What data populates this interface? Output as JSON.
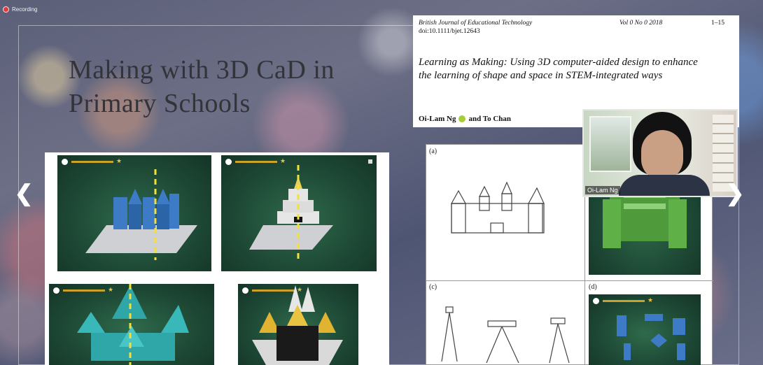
{
  "recording": {
    "label": "Recording"
  },
  "slide": {
    "title": "Making with 3D CaD in Primary Schools"
  },
  "document": {
    "journal": "British Journal of Educational Technology",
    "volume": "Vol 0 No 0 2018",
    "pages": "1–15",
    "doi": "doi:10.1111/bjet.12643",
    "title": "Learning as Making: Using 3D computer-aided design to enhance the learning of shape and space in STEM-integrated ways",
    "author_1": "Oi-Lam Ng",
    "author_connector": "and To Chan"
  },
  "figure": {
    "label_a": "(a)",
    "label_c": "(c)",
    "label_d": "(d)"
  },
  "video": {
    "participant_name": "Oi-Lam Ng"
  },
  "colors": {
    "accent_yellow": "#f3e03c",
    "castle_blue": "#2f6fb0",
    "tile_green": "#1e4a36"
  },
  "icons": {
    "prev": "chevron-left-icon",
    "next": "chevron-right-icon",
    "record": "record-dot-icon"
  }
}
